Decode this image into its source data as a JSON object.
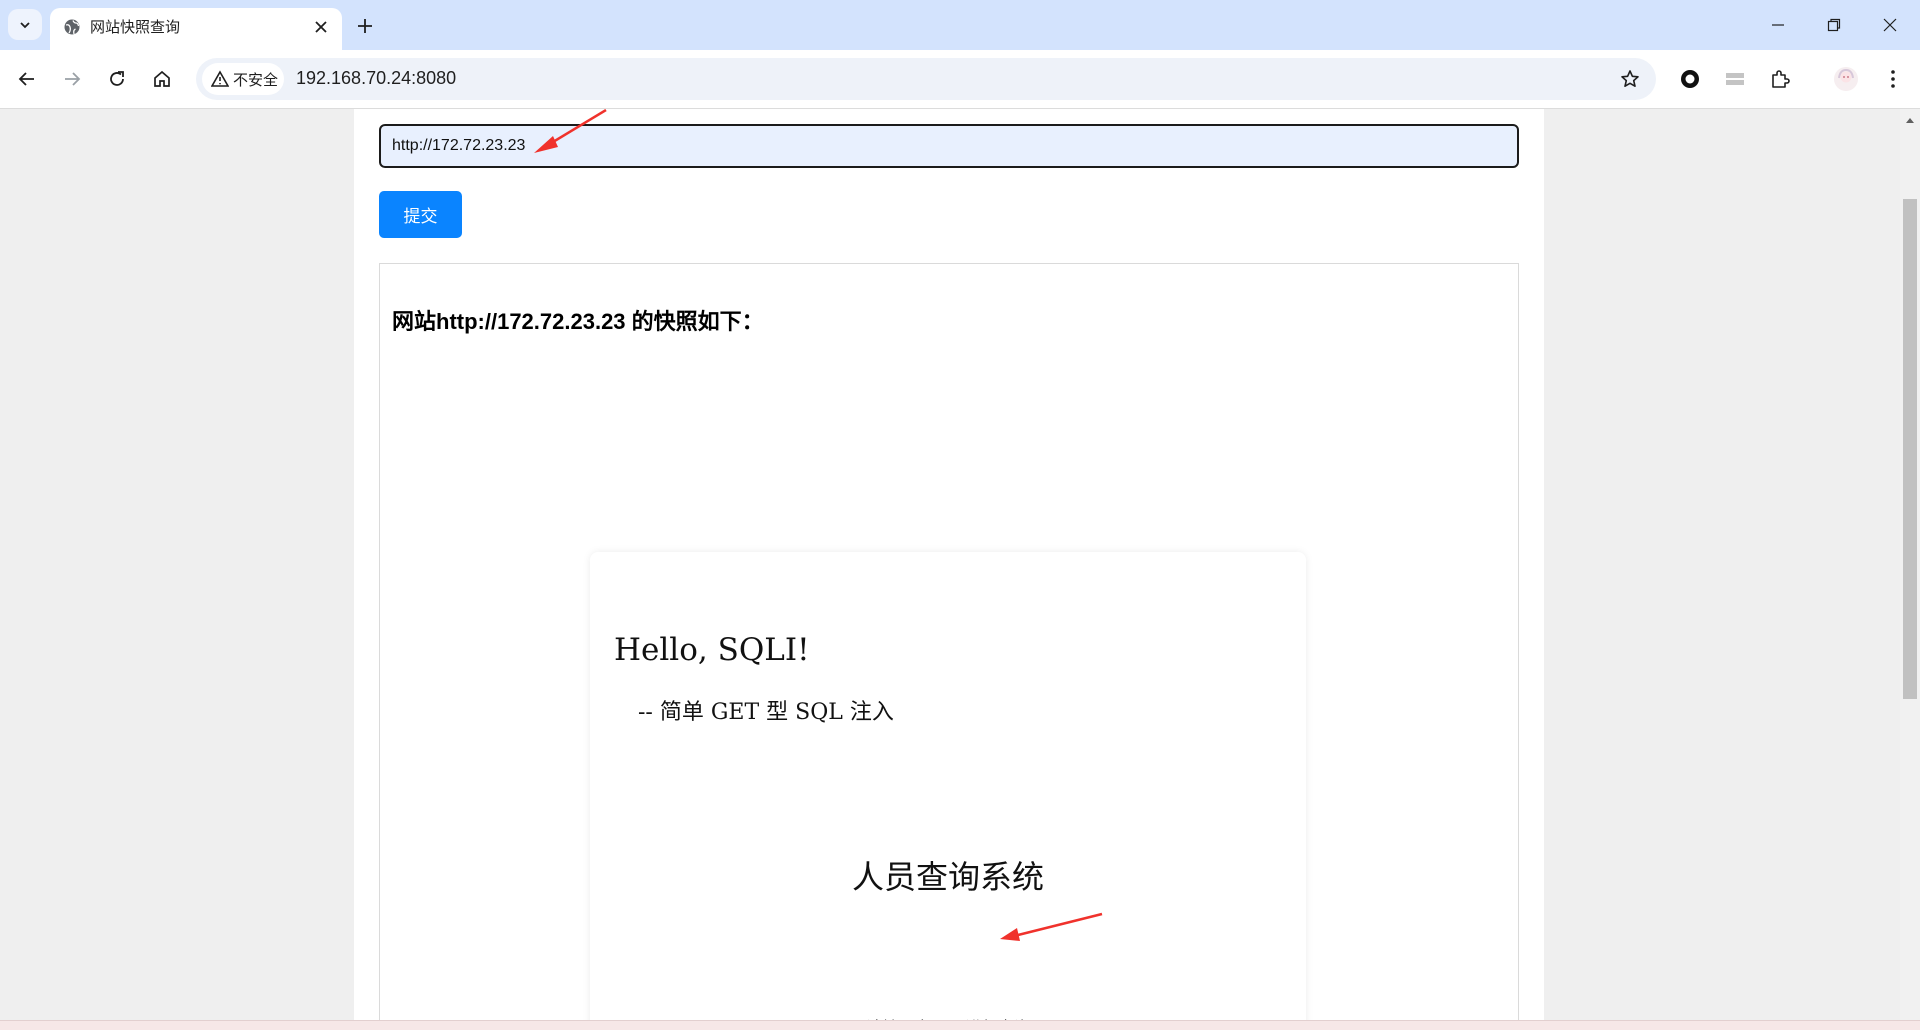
{
  "browser": {
    "tab": {
      "title": "网站快照查询"
    },
    "omnibox": {
      "security_label": "不安全",
      "url": "192.168.70.24:8080"
    }
  },
  "page": {
    "url_input_value": "http://172.72.23.23",
    "submit_label": "提交",
    "result_heading": "网站http://172.72.23.23 的快照如下：",
    "snapshot": {
      "hello": "Hello, SQLI!",
      "subtitle": "-- 简单 GET 型 SQL 注入",
      "system_title": "人员查询系统",
      "hint": "请输入人员ID进行查询"
    }
  },
  "colors": {
    "tabstrip_bg": "#d3e3fd",
    "submit_bg": "#0a84ff",
    "input_bg": "#e8f0fe",
    "annotation_arrow": "#f0322c"
  },
  "icons": [
    "tab-search-icon",
    "globe-icon",
    "close-icon",
    "plus-icon",
    "minimize-icon",
    "restore-icon",
    "window-close-icon",
    "back-icon",
    "forward-icon",
    "reload-icon",
    "home-icon",
    "warning-icon",
    "star-icon",
    "record-extension-icon",
    "list-extension-icon",
    "extensions-puzzle-icon",
    "profile-avatar-icon",
    "kebab-menu-icon"
  ]
}
